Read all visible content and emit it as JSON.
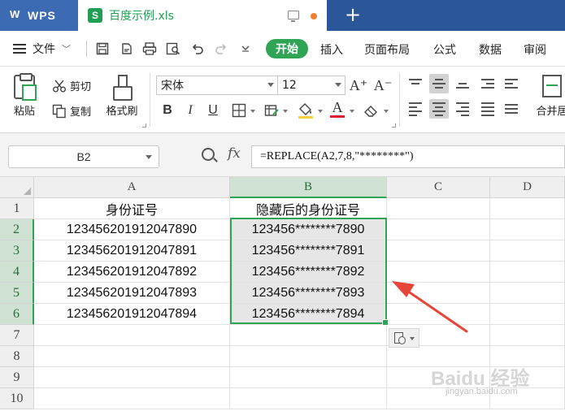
{
  "titlebar": {
    "app_name": "WPS",
    "doc_icon_letter": "S",
    "doc_name": "百度示例.xls",
    "new_tab": "+"
  },
  "menu": {
    "file_label": "文件",
    "tabs": [
      "开始",
      "插入",
      "页面布局",
      "公式",
      "数据",
      "审阅"
    ],
    "active_tab": "开始"
  },
  "ribbon": {
    "paste": "粘贴",
    "cut": "剪切",
    "copy": "复制",
    "format_painter": "格式刷",
    "font_name": "宋体",
    "font_size": "12",
    "bold": "B",
    "italic": "I",
    "underline": "U",
    "font_color_letter": "A",
    "grow_font": "A⁺",
    "shrink_font": "A⁻",
    "merge_center": "合并居",
    "accent_color": "#2ea454",
    "font_color": "#e0202a",
    "fill_color": "#f4d03f"
  },
  "formula_bar": {
    "name_box": "B2",
    "fx": "fx",
    "formula": "=REPLACE(A2,7,8,\"********\")"
  },
  "grid": {
    "columns": [
      "A",
      "B",
      "C",
      "D"
    ],
    "selected_column": "B",
    "rows": [
      "1",
      "2",
      "3",
      "4",
      "5",
      "6",
      "7",
      "8",
      "9",
      "10"
    ],
    "header_row": [
      "身份证号",
      "隐藏后的身份证号"
    ],
    "data_rows": [
      [
        "12345620191204789​0",
        "123456********7890"
      ],
      [
        "123456201912047891",
        "123456********7891"
      ],
      [
        "123456201912047892",
        "123456********7892"
      ],
      [
        "123456201912047893",
        "123456********7893"
      ],
      [
        "123456201912047894",
        "123456********7894"
      ]
    ]
  },
  "watermark": {
    "brand": "Baidu 经验",
    "url": "jingyan.baidu.com"
  }
}
